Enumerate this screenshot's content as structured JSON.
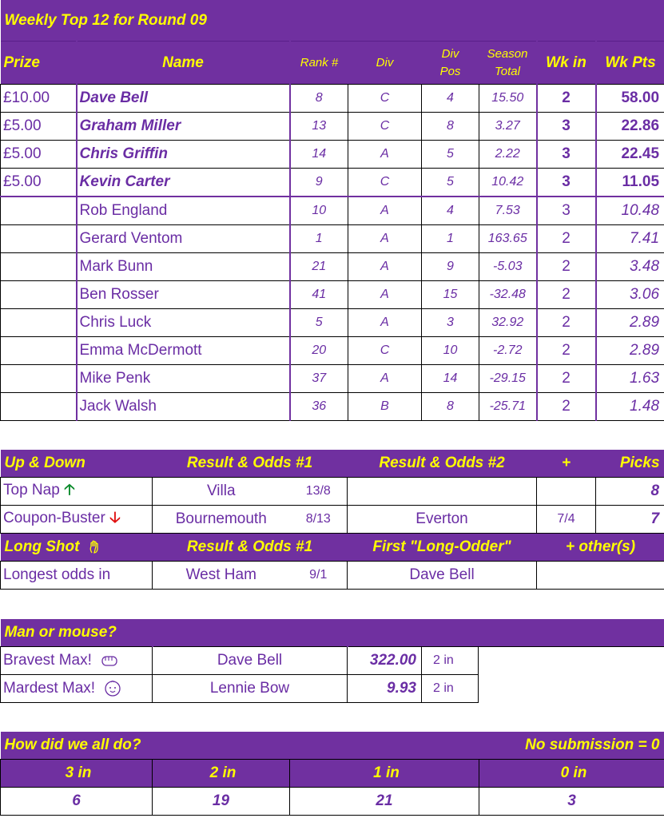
{
  "top12": {
    "title": "Weekly Top 12 for Round 09",
    "headers": {
      "prize": "Prize",
      "name": "Name",
      "rank": "Rank #",
      "div": "Div",
      "div_pos_1": "Div",
      "div_pos_2": "Pos",
      "season_1": "Season",
      "season_2": "Total",
      "wk_in": "Wk in",
      "wk_pts": "Wk Pts"
    },
    "rows": [
      {
        "prize": "£10.00",
        "name": "Dave Bell",
        "rank": "8",
        "div": "C",
        "div_pos": "4",
        "season": "15.50",
        "wk_in": "2",
        "wk_pts": "58.00"
      },
      {
        "prize": "£5.00",
        "name": "Graham Miller",
        "rank": "13",
        "div": "C",
        "div_pos": "8",
        "season": "3.27",
        "wk_in": "3",
        "wk_pts": "22.86"
      },
      {
        "prize": "£5.00",
        "name": "Chris Griffin",
        "rank": "14",
        "div": "A",
        "div_pos": "5",
        "season": "2.22",
        "wk_in": "3",
        "wk_pts": "22.45"
      },
      {
        "prize": "£5.00",
        "name": "Kevin Carter",
        "rank": "9",
        "div": "C",
        "div_pos": "5",
        "season": "10.42",
        "wk_in": "3",
        "wk_pts": "11.05"
      },
      {
        "prize": "",
        "name": "Rob England",
        "rank": "10",
        "div": "A",
        "div_pos": "4",
        "season": "7.53",
        "wk_in": "3",
        "wk_pts": "10.48"
      },
      {
        "prize": "",
        "name": "Gerard Ventom",
        "rank": "1",
        "div": "A",
        "div_pos": "1",
        "season": "163.65",
        "wk_in": "2",
        "wk_pts": "7.41"
      },
      {
        "prize": "",
        "name": "Mark Bunn",
        "rank": "21",
        "div": "A",
        "div_pos": "9",
        "season": "-5.03",
        "wk_in": "2",
        "wk_pts": "3.48"
      },
      {
        "prize": "",
        "name": "Ben Rosser",
        "rank": "41",
        "div": "A",
        "div_pos": "15",
        "season": "-32.48",
        "wk_in": "2",
        "wk_pts": "3.06"
      },
      {
        "prize": "",
        "name": "Chris Luck",
        "rank": "5",
        "div": "A",
        "div_pos": "3",
        "season": "32.92",
        "wk_in": "2",
        "wk_pts": "2.89"
      },
      {
        "prize": "",
        "name": "Emma McDermott",
        "rank": "20",
        "div": "C",
        "div_pos": "10",
        "season": "-2.72",
        "wk_in": "2",
        "wk_pts": "2.89"
      },
      {
        "prize": "",
        "name": "Mike Penk",
        "rank": "37",
        "div": "A",
        "div_pos": "14",
        "season": "-29.15",
        "wk_in": "2",
        "wk_pts": "1.63"
      },
      {
        "prize": "",
        "name": "Jack Walsh",
        "rank": "36",
        "div": "B",
        "div_pos": "8",
        "season": "-25.71",
        "wk_in": "2",
        "wk_pts": "1.48"
      }
    ]
  },
  "updown": {
    "h1": "Up & Down",
    "h2": "Result & Odds #1",
    "h3": "Result & Odds #2",
    "h4": "+",
    "h5": "Picks",
    "top_nap": {
      "label": "Top Nap",
      "arrow": "🡡",
      "team1": "Villa",
      "odds1": "13/8",
      "team2": "",
      "odds2": "",
      "picks": "8"
    },
    "coupon": {
      "label": "Coupon-Buster",
      "arrow": "🡣",
      "team1": "Bournemouth",
      "odds1": "8/13",
      "team2": "Everton",
      "odds2": "7/4",
      "picks": "7"
    },
    "long_hdr": {
      "h1": "Long Shot",
      "h2": "Result & Odds #1",
      "h3": "First \"Long-Odder\"",
      "h4": "+ other(s)"
    },
    "longest": {
      "label": "Longest odds in",
      "team": "West Ham",
      "odds": "9/1",
      "who": "Dave Bell",
      "others": ""
    }
  },
  "mouse": {
    "title": "Man or mouse?",
    "bravest": {
      "label": "Bravest Max!",
      "icon": "fist-icon",
      "who": "Dave Bell",
      "value": "322.00",
      "in": "2 in"
    },
    "mardest": {
      "label": "Mardest Max!",
      "icon": "baby-face-icon",
      "who": "Lennie Bow",
      "value": "9.93",
      "in": "2 in"
    }
  },
  "summary": {
    "title": "How did we all do?",
    "note": "No submission = 0",
    "cols": [
      "3 in",
      "2 in",
      "1 in",
      "0 in"
    ],
    "vals": [
      "6",
      "19",
      "21",
      "3"
    ]
  },
  "colors": {
    "header_bg": "#7030a0",
    "header_text": "#ffff00",
    "body_text": "#6a2da4",
    "up": "#0a8a2a",
    "down": "#e01010"
  }
}
